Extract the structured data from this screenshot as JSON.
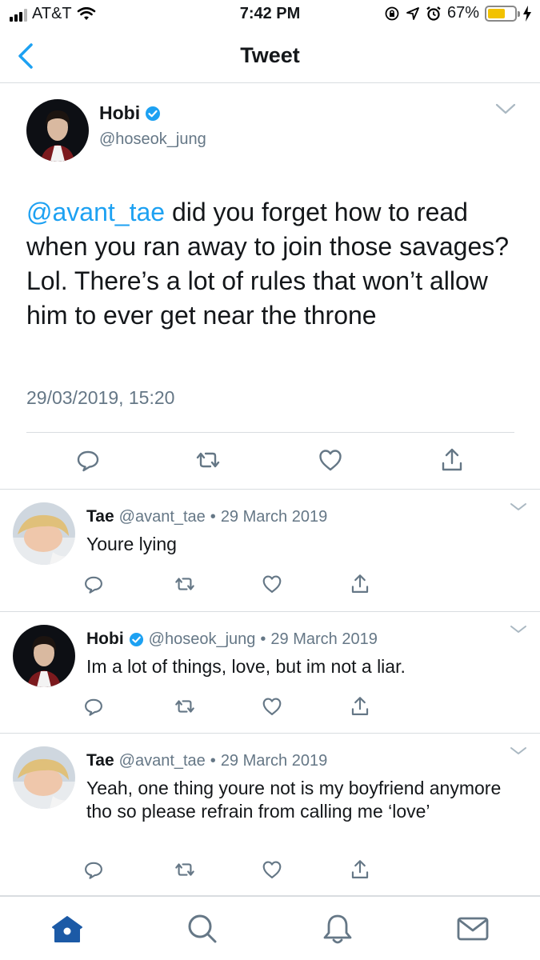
{
  "status_bar": {
    "carrier": "AT&T",
    "time": "7:42 PM",
    "battery_percent": "67%",
    "battery_level": 0.67
  },
  "header": {
    "title": "Tweet"
  },
  "main_tweet": {
    "author_name": "Hobi",
    "author_handle": "@hoseok_jung",
    "verified": true,
    "mention": "@avant_tae",
    "text": " did you forget how to read when you ran away to join those savages? Lol. There’s a lot of rules that won’t allow him to ever get near the throne",
    "timestamp": "29/03/2019, 15:20"
  },
  "replies": [
    {
      "name": "Tae",
      "handle": "@avant_tae",
      "date": "29 March 2019",
      "verified": false,
      "text": "Youre lying"
    },
    {
      "name": "Hobi",
      "handle": "@hoseok_jung",
      "date": "29 March 2019",
      "verified": true,
      "text": "Im a lot of things, love, but im not a liar."
    },
    {
      "name": "Tae",
      "handle": "@avant_tae",
      "date": "29 March 2019",
      "verified": false,
      "text": "Yeah, one thing youre not is my boyfriend anymore tho so please refrain from calling me ‘love’"
    }
  ],
  "separator": "•",
  "tab_bar": {
    "active_tab": "home",
    "tabs": [
      "home-icon",
      "search-icon",
      "notifications-icon",
      "messages-icon"
    ]
  },
  "colors": {
    "accent": "#1da1f2",
    "text": "#14171a",
    "secondary": "#657786",
    "divider": "#d9dde0",
    "battery": "#f2c200",
    "tab_active": "#1c5aa6"
  }
}
